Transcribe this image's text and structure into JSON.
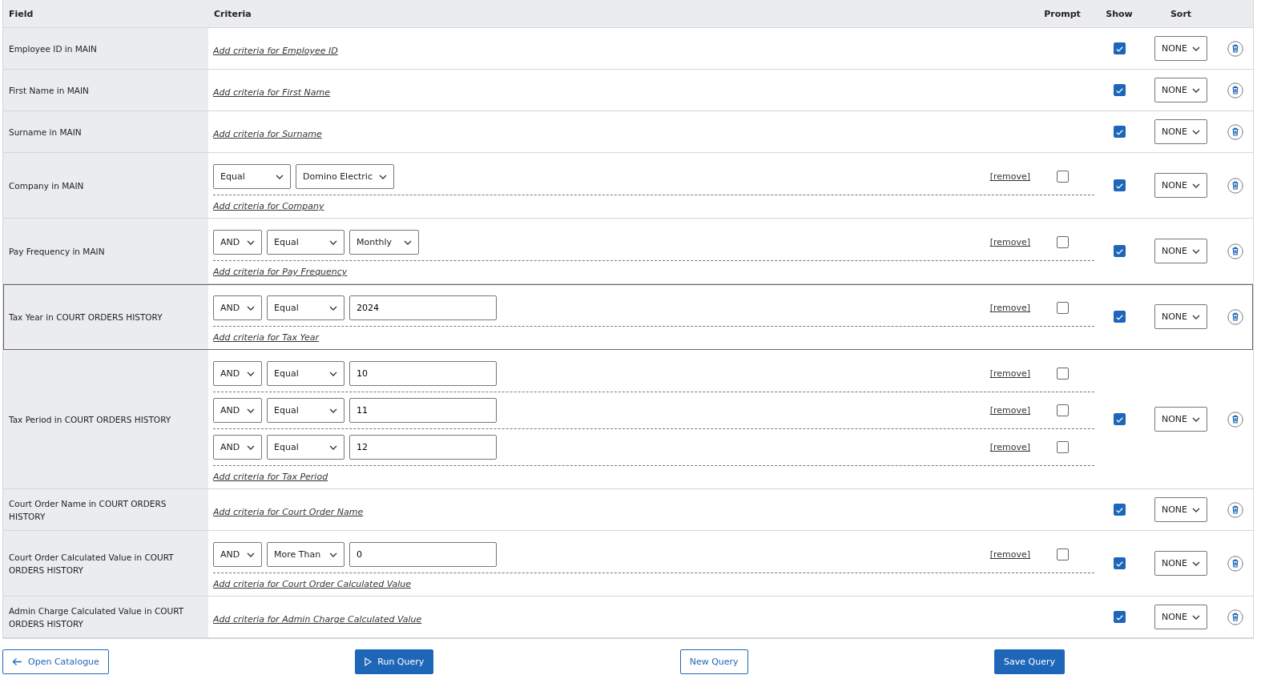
{
  "columns": [
    "Field",
    "Criteria",
    "Prompt",
    "Show",
    "Sort"
  ],
  "rows": [
    {
      "field": "Employee ID in MAIN",
      "selected": false,
      "conditions": [],
      "add_link": "Add criteria for Employee ID",
      "show": true,
      "sort": "NONE"
    },
    {
      "field": "First Name in MAIN",
      "selected": false,
      "conditions": [],
      "add_link": "Add criteria for First Name",
      "show": true,
      "sort": "NONE"
    },
    {
      "field": "Surname in MAIN",
      "selected": false,
      "conditions": [],
      "add_link": "Add criteria for Surname",
      "show": true,
      "sort": "NONE"
    },
    {
      "field": "Company in MAIN",
      "selected": false,
      "conditions": [
        {
          "operator": "Equal",
          "value": "Domino Electric",
          "kind": "select",
          "remove": "[remove]",
          "prompt": false
        }
      ],
      "add_link": "Add criteria for Company",
      "show": true,
      "sort": "NONE"
    },
    {
      "field": "Pay Frequency in MAIN",
      "selected": false,
      "conditions": [
        {
          "conjunction": "AND",
          "operator": "Equal",
          "value": "Monthly",
          "kind": "select",
          "remove": "[remove]",
          "prompt": false
        }
      ],
      "add_link": "Add criteria for Pay Frequency",
      "show": true,
      "sort": "NONE"
    },
    {
      "field": "Tax Year in COURT ORDERS HISTORY",
      "selected": true,
      "conditions": [
        {
          "conjunction": "AND",
          "operator": "Equal",
          "value": "2024",
          "kind": "input",
          "remove": "[remove]",
          "prompt": false
        }
      ],
      "add_link": "Add criteria for Tax Year",
      "show": true,
      "sort": "NONE"
    },
    {
      "field": "Tax Period in COURT ORDERS HISTORY",
      "selected": false,
      "conditions": [
        {
          "conjunction": "AND",
          "operator": "Equal",
          "value": "10",
          "kind": "input",
          "remove": "[remove]",
          "prompt": false
        },
        {
          "conjunction": "AND",
          "operator": "Equal",
          "value": "11",
          "kind": "input",
          "remove": "[remove]",
          "prompt": false
        },
        {
          "conjunction": "AND",
          "operator": "Equal",
          "value": "12",
          "kind": "input",
          "remove": "[remove]",
          "prompt": false
        }
      ],
      "add_link": "Add criteria for Tax Period",
      "show": true,
      "sort": "NONE"
    },
    {
      "field": "Court Order Name in COURT ORDERS HISTORY",
      "selected": false,
      "conditions": [],
      "add_link": "Add criteria for Court Order Name",
      "show": true,
      "sort": "NONE"
    },
    {
      "field": "Court Order Calculated Value in COURT ORDERS HISTORY",
      "selected": false,
      "conditions": [
        {
          "conjunction": "AND",
          "operator": "More Than",
          "value": "0",
          "kind": "input",
          "remove": "[remove]",
          "prompt": false
        }
      ],
      "add_link": "Add criteria for Court Order Calculated Value",
      "show": true,
      "sort": "NONE"
    },
    {
      "field": "Admin Charge Calculated Value in COURT ORDERS HISTORY",
      "selected": false,
      "conditions": [],
      "add_link": "Add criteria for Admin Charge Calculated Value",
      "show": true,
      "sort": "NONE"
    }
  ],
  "buttons": [
    {
      "label": "Open Catalogue",
      "kind": "back"
    },
    {
      "label": "Run Query",
      "kind": "run"
    },
    {
      "label": "New Query",
      "kind": "outline"
    },
    {
      "label": "Save Query",
      "kind": "primary"
    }
  ]
}
